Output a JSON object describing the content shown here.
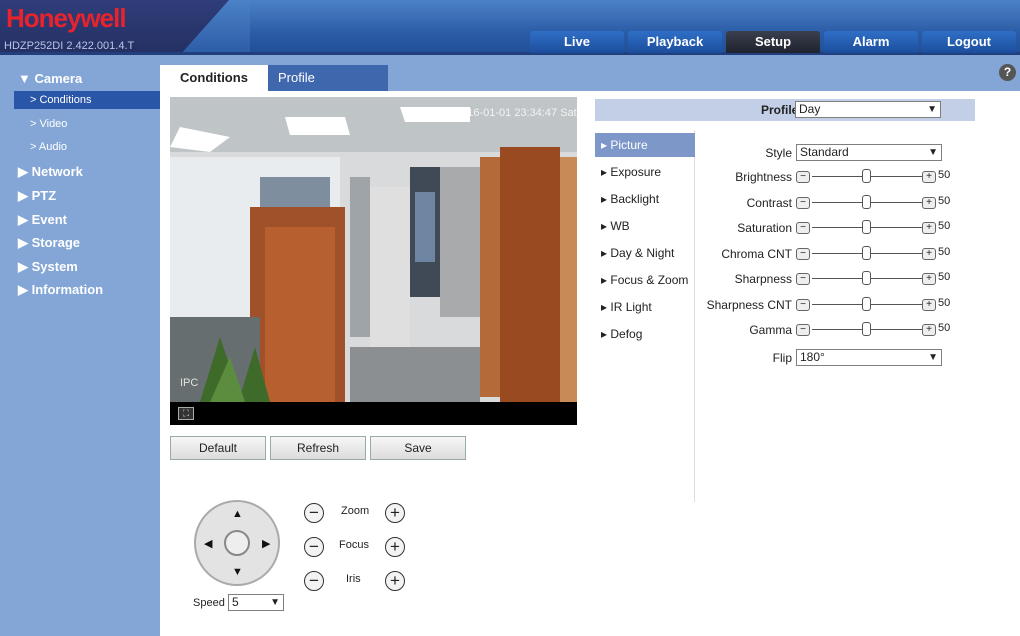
{
  "header": {
    "logo": "Honeywell",
    "model": "HDZP252DI  2.422.001.4.T",
    "nav": [
      "Live",
      "Playback",
      "Setup",
      "Alarm",
      "Logout"
    ]
  },
  "sidebar": {
    "camera_label": "Camera",
    "camera_items": [
      "Conditions",
      "Video",
      "Audio"
    ],
    "categories": [
      "Network",
      "PTZ",
      "Event",
      "Storage",
      "System",
      "Information"
    ]
  },
  "tabs": [
    "Conditions",
    "Profile Management"
  ],
  "video": {
    "osd_time": "2016-01-01 23:34:47 Sat",
    "osd_label": "IPC"
  },
  "buttons": {
    "default": "Default",
    "refresh": "Refresh",
    "save": "Save"
  },
  "ptz": {
    "zoom": "Zoom",
    "focus": "Focus",
    "iris": "Iris",
    "minus": "−",
    "plus": "+",
    "speed_label": "Speed",
    "speed_value": "5"
  },
  "profile": {
    "label": "Profile",
    "value": "Day"
  },
  "submenu": [
    "Picture",
    "Exposure",
    "Backlight",
    "WB",
    "Day & Night",
    "Focus & Zoom",
    "IR Light",
    "Defog"
  ],
  "picture": {
    "style_label": "Style",
    "style_value": "Standard",
    "sliders": [
      {
        "label": "Brightness",
        "value": "50"
      },
      {
        "label": "Contrast",
        "value": "50"
      },
      {
        "label": "Saturation",
        "value": "50"
      },
      {
        "label": "Chroma CNT",
        "value": "50"
      },
      {
        "label": "Sharpness",
        "value": "50"
      },
      {
        "label": "Sharpness CNT",
        "value": "50"
      },
      {
        "label": "Gamma",
        "value": "50"
      }
    ],
    "flip_label": "Flip",
    "flip_value": "180°"
  },
  "colors": {
    "header": "#2b5ca6",
    "sidebar": "#83a6d6",
    "active_tab": "#2a56a7",
    "logo": "#e8232d"
  }
}
